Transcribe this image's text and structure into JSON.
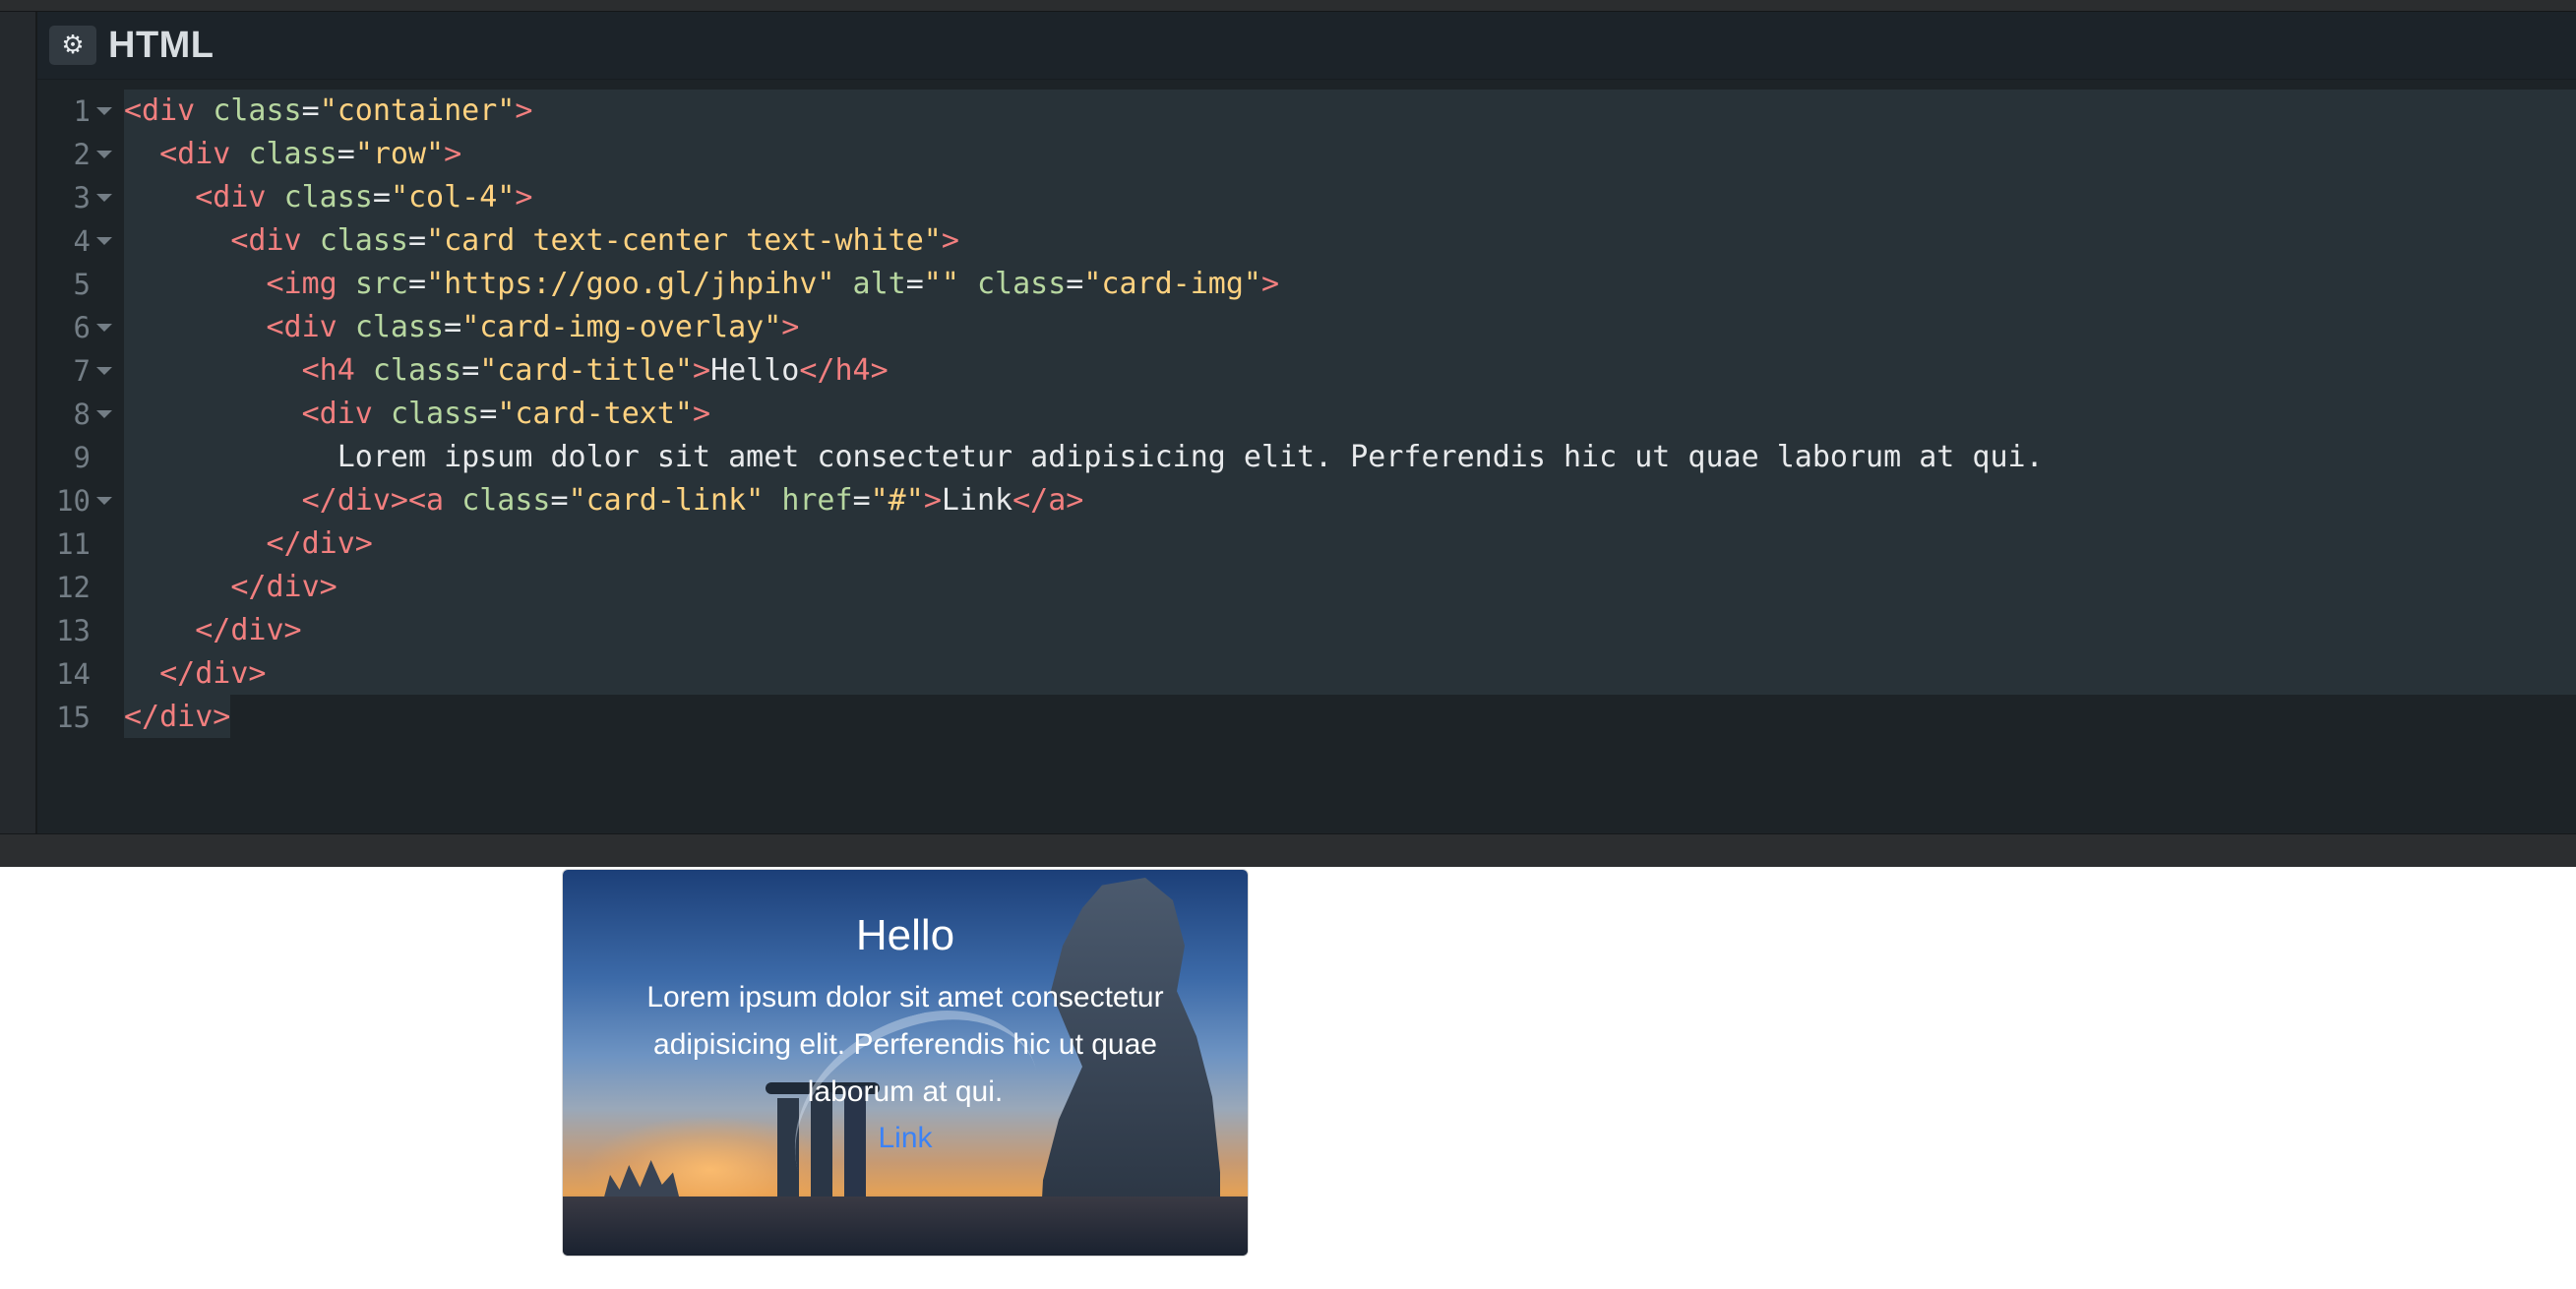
{
  "editor": {
    "panel_icon": "gear-icon",
    "panel_title": "HTML",
    "line_numbers": [
      "1",
      "2",
      "3",
      "4",
      "5",
      "6",
      "7",
      "8",
      "9",
      "10",
      "11",
      "12",
      "13",
      "14",
      "15"
    ],
    "fold_lines": [
      1,
      2,
      3,
      4,
      6,
      7,
      8,
      10
    ],
    "lines": [
      [
        {
          "t": "tag",
          "v": "<div "
        },
        {
          "t": "attr",
          "v": "class"
        },
        {
          "t": "txt",
          "v": "="
        },
        {
          "t": "str",
          "v": "\"container\""
        },
        {
          "t": "tag",
          "v": ">"
        }
      ],
      [
        {
          "t": "txt",
          "v": "  "
        },
        {
          "t": "tag",
          "v": "<div "
        },
        {
          "t": "attr",
          "v": "class"
        },
        {
          "t": "txt",
          "v": "="
        },
        {
          "t": "str",
          "v": "\"row\""
        },
        {
          "t": "tag",
          "v": ">"
        }
      ],
      [
        {
          "t": "txt",
          "v": "    "
        },
        {
          "t": "tag",
          "v": "<div "
        },
        {
          "t": "attr",
          "v": "class"
        },
        {
          "t": "txt",
          "v": "="
        },
        {
          "t": "str",
          "v": "\"col-4\""
        },
        {
          "t": "tag",
          "v": ">"
        }
      ],
      [
        {
          "t": "txt",
          "v": "      "
        },
        {
          "t": "tag",
          "v": "<div "
        },
        {
          "t": "attr",
          "v": "class"
        },
        {
          "t": "txt",
          "v": "="
        },
        {
          "t": "str",
          "v": "\"card text-center text-white\""
        },
        {
          "t": "tag",
          "v": ">"
        }
      ],
      [
        {
          "t": "txt",
          "v": "        "
        },
        {
          "t": "tag",
          "v": "<img "
        },
        {
          "t": "attr",
          "v": "src"
        },
        {
          "t": "txt",
          "v": "="
        },
        {
          "t": "str",
          "v": "\"https://goo.gl/jhpihv\""
        },
        {
          "t": "txt",
          "v": " "
        },
        {
          "t": "attr",
          "v": "alt"
        },
        {
          "t": "txt",
          "v": "="
        },
        {
          "t": "str",
          "v": "\"\""
        },
        {
          "t": "txt",
          "v": " "
        },
        {
          "t": "attr",
          "v": "class"
        },
        {
          "t": "txt",
          "v": "="
        },
        {
          "t": "str",
          "v": "\"card-img\""
        },
        {
          "t": "tag",
          "v": ">"
        }
      ],
      [
        {
          "t": "txt",
          "v": "        "
        },
        {
          "t": "tag",
          "v": "<div "
        },
        {
          "t": "attr",
          "v": "class"
        },
        {
          "t": "txt",
          "v": "="
        },
        {
          "t": "str",
          "v": "\"card-img-overlay\""
        },
        {
          "t": "tag",
          "v": ">"
        }
      ],
      [
        {
          "t": "txt",
          "v": "          "
        },
        {
          "t": "tag",
          "v": "<h4 "
        },
        {
          "t": "attr",
          "v": "class"
        },
        {
          "t": "txt",
          "v": "="
        },
        {
          "t": "str",
          "v": "\"card-title\""
        },
        {
          "t": "tag",
          "v": ">"
        },
        {
          "t": "txt",
          "v": "Hello"
        },
        {
          "t": "tag",
          "v": "</h4>"
        }
      ],
      [
        {
          "t": "txt",
          "v": "          "
        },
        {
          "t": "tag",
          "v": "<div "
        },
        {
          "t": "attr",
          "v": "class"
        },
        {
          "t": "txt",
          "v": "="
        },
        {
          "t": "str",
          "v": "\"card-text\""
        },
        {
          "t": "tag",
          "v": ">"
        }
      ],
      [
        {
          "t": "txt",
          "v": "            Lorem ipsum dolor sit amet consectetur adipisicing elit. Perferendis hic ut quae laborum at qui."
        }
      ],
      [
        {
          "t": "txt",
          "v": "          "
        },
        {
          "t": "tag",
          "v": "</div><a "
        },
        {
          "t": "attr",
          "v": "class"
        },
        {
          "t": "txt",
          "v": "="
        },
        {
          "t": "str",
          "v": "\"card-link\""
        },
        {
          "t": "txt",
          "v": " "
        },
        {
          "t": "attr",
          "v": "href"
        },
        {
          "t": "txt",
          "v": "="
        },
        {
          "t": "str",
          "v": "\"#\""
        },
        {
          "t": "tag",
          "v": ">"
        },
        {
          "t": "txt",
          "v": "Link"
        },
        {
          "t": "tag",
          "v": "</a>"
        }
      ],
      [
        {
          "t": "txt",
          "v": "        "
        },
        {
          "t": "tag",
          "v": "</div>"
        }
      ],
      [
        {
          "t": "txt",
          "v": "      "
        },
        {
          "t": "tag",
          "v": "</div>"
        }
      ],
      [
        {
          "t": "txt",
          "v": "    "
        },
        {
          "t": "tag",
          "v": "</div>"
        }
      ],
      [
        {
          "t": "txt",
          "v": "  "
        },
        {
          "t": "tag",
          "v": "</div>"
        }
      ],
      [
        {
          "t": "tag",
          "v": "</div>"
        }
      ]
    ]
  },
  "preview": {
    "card_title": "Hello",
    "card_text": "Lorem ipsum dolor sit amet consectetur adipisicing elit. Perferendis hic ut quae laborum at qui.",
    "card_link": "Link"
  },
  "colors": {
    "tag": "#f27f7f",
    "attribute": "#b7d7a0",
    "string": "#ffd280",
    "text": "#e8eaec",
    "link": "#3b82f6"
  }
}
